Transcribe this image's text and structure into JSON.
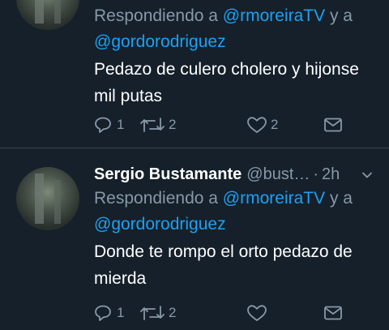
{
  "tweets": [
    {
      "reply_prefix": "Respondiendo a ",
      "mention1": "@rmoreiraTV",
      "conj": " y a",
      "mention2": "@gordorodriguez",
      "text": "Pedazo de culero cholero y hijonse mil putas",
      "reply_count": "1",
      "retweet_count": "2",
      "like_count": "2"
    },
    {
      "name": "Sergio Bustamante",
      "handle": "@bust…",
      "dot": "·",
      "time": "2h",
      "reply_prefix": "Respondiendo a ",
      "mention1": "@rmoreiraTV",
      "conj": " y a",
      "mention2": "@gordorodriguez",
      "text": "Donde te rompo el orto pedazo de mierda",
      "reply_count": "1",
      "retweet_count": "2",
      "like_count": ""
    }
  ],
  "icons": [
    "reply-icon",
    "retweet-icon",
    "like-icon",
    "direct-message-icon",
    "chevron-down-icon"
  ],
  "colors": {
    "background": "#15202b",
    "muted": "#8899a6",
    "link": "#1da1f2",
    "divider": "#38444d"
  }
}
